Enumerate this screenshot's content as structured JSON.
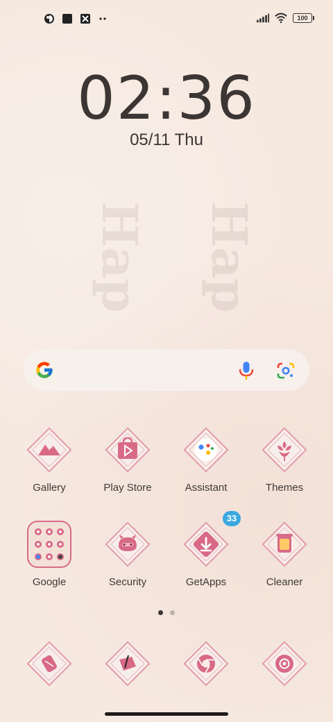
{
  "status_bar": {
    "left_icons": [
      "circle-half-icon",
      "square-app-icon",
      "no-image-icon",
      "more-dots-icon"
    ],
    "right_icons": [
      "signal-icon",
      "wifi-icon",
      "battery-icon"
    ],
    "battery_level": "100"
  },
  "clock": {
    "time": "02:36",
    "date": "05/11",
    "day": "Thu"
  },
  "wallpaper_text": [
    "Hap",
    "Hap"
  ],
  "search": {
    "icons": [
      "google-logo-icon",
      "microphone-icon",
      "google-lens-icon"
    ]
  },
  "apps_row1": [
    {
      "label": "Gallery",
      "icon": "gallery-icon"
    },
    {
      "label": "Play Store",
      "icon": "play-store-icon"
    },
    {
      "label": "Assistant",
      "icon": "assistant-icon"
    },
    {
      "label": "Themes",
      "icon": "themes-icon"
    }
  ],
  "apps_row2": [
    {
      "label": "Google",
      "icon": "google-folder-icon"
    },
    {
      "label": "Security",
      "icon": "security-icon"
    },
    {
      "label": "GetApps",
      "icon": "getapps-icon",
      "badge": "33"
    },
    {
      "label": "Cleaner",
      "icon": "cleaner-icon"
    }
  ],
  "dock": [
    {
      "icon": "phone-icon"
    },
    {
      "icon": "messages-icon"
    },
    {
      "icon": "chrome-icon"
    },
    {
      "icon": "camera-icon"
    }
  ],
  "page_indicator": {
    "pages": 2,
    "current": 1
  },
  "colors": {
    "background": "#f6e9e0",
    "icon_pink": "#d86a86",
    "icon_frame": "#e5a1b0",
    "badge": "#3aa8e0"
  }
}
